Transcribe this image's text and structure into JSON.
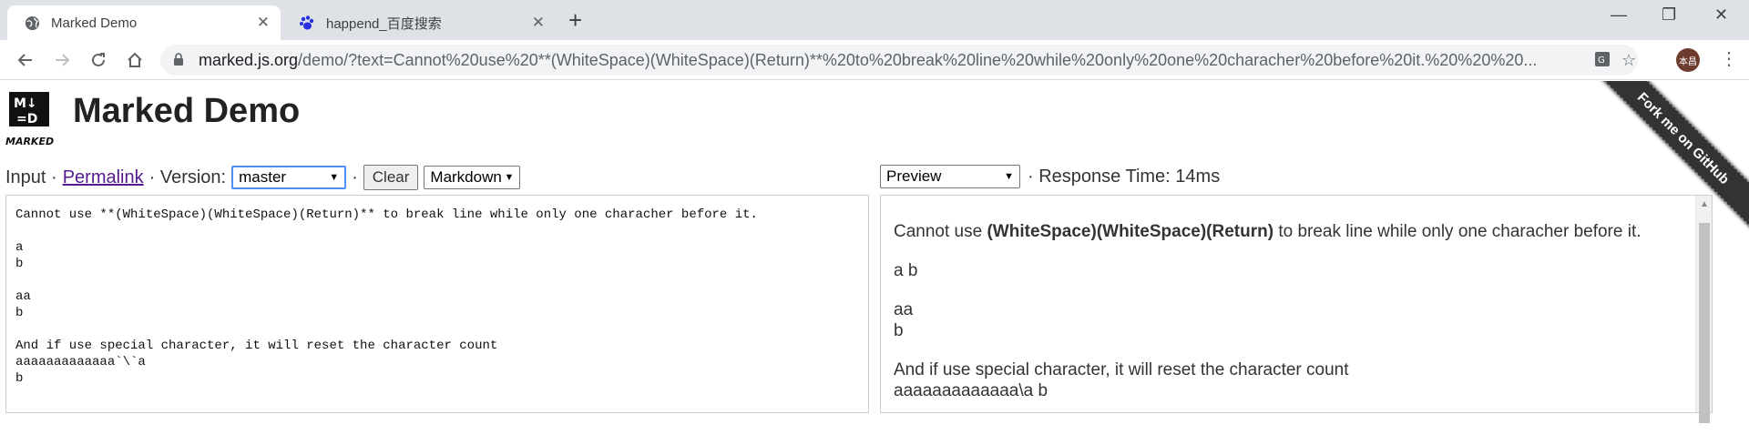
{
  "browser": {
    "tabs": [
      {
        "title": "Marked Demo",
        "icon": "globe-icon",
        "active": true
      },
      {
        "title": "happend_百度搜索",
        "icon": "baidu-paw-icon",
        "active": false
      }
    ],
    "new_tab": "+",
    "window_controls": {
      "minimize": "—",
      "maximize": "❐",
      "close": "✕"
    },
    "url_host": "marked.js.org",
    "url_rest": "/demo/?text=Cannot%20use%20**(WhiteSpace)(WhiteSpace)(Return)**%20to%20break%20line%20while%20only%20one%20characher%20before%20it.%20%20%20...",
    "avatar_text": "本昌"
  },
  "page": {
    "logo_text": "MARKED",
    "title": "Marked Demo",
    "ribbon": "Fork me on GitHub",
    "input_label": "Input ·",
    "permalink": "Permalink",
    "version_label": "· Version:",
    "version_value": "master",
    "sep": "·",
    "clear_label": "Clear",
    "format_value": "Markdown",
    "preview_value": "Preview",
    "response_time": "· Response Time: 14ms"
  },
  "editor": {
    "text": "Cannot use **(WhiteSpace)(WhiteSpace)(Return)** to break line while only one characher before it.\n\na\nb\n\naa\nb\n\nAnd if use special character, it will reset the character count\naaaaaaaaaaaaa`\\`a\nb"
  },
  "preview": {
    "p1_pre": "Cannot use ",
    "p1_bold": "(WhiteSpace)(WhiteSpace)(Return)",
    "p1_post": " to break line while only one characher before it.",
    "p2": "a b",
    "p3_line1": "aa",
    "p3_line2": "b",
    "p4_line1": "And if use special character, it will reset the character count",
    "p4_line2": "aaaaaaaaaaaaa\\a b"
  }
}
